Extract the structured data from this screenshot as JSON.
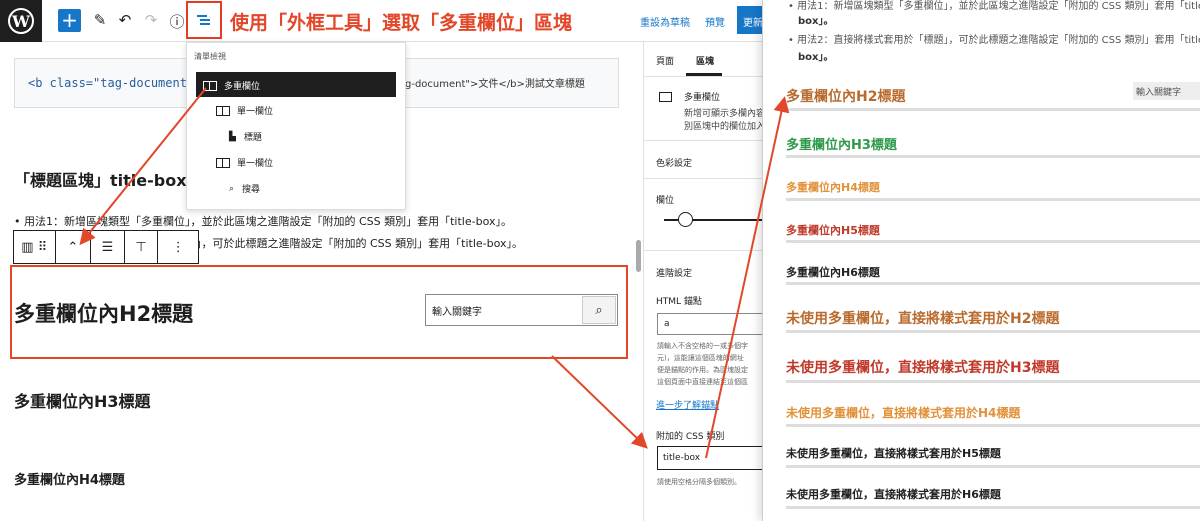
{
  "colors": {
    "accent": "#1677c9",
    "annotation": "#e24729",
    "dark": "#1e1e1e",
    "h2": "#b96b2e",
    "h3": "#2e9a4a",
    "h4": "#e1923a",
    "h5": "#c0392b",
    "h6": "#222222"
  },
  "topbar": {
    "caption": "使用「外框工具」選取「多重欄位」區塊",
    "save_draft": "重設為草稿",
    "preview": "預覽",
    "update": "更新"
  },
  "editor": {
    "code_left": "<b class=\"tag-document\"",
    "code_right": "g-document\">文件</b>測試文章標題",
    "heading": "「標題區塊」title-box",
    "usage1": "• 用法1：新增區塊類型「多重欄位」，並於此區塊之進階設定「附加的 CSS 類別」套用「title-box」。",
    "usage2": "」，可於此標題之進階設定「附加的 CSS 類別」套用「title-box」。",
    "h2": "多重欄位內H2標題",
    "search_placeholder": "輸入關鍵字",
    "h3": "多重欄位內H3標題",
    "h4": "多重欄位內H4標題"
  },
  "listview": {
    "title": "清單檢視",
    "items": [
      "多重欄位",
      "單一欄位",
      "標題",
      "單一欄位",
      "搜尋"
    ]
  },
  "sidebar": {
    "tab_page": "頁面",
    "tab_block": "區塊",
    "block_name": "多重欄位",
    "block_desc1": "新增可顯示多欄內容",
    "block_desc2": "別區塊中的欄位加入",
    "color_settings": "色彩設定",
    "columns_label": "欄位",
    "advanced": "進階設定",
    "html_anchor": "HTML 錨點",
    "anchor_value": "a",
    "anchor_help": [
      "請輸入不含空格的一或多個字",
      "元)，這能讓這個區塊的網址",
      "便是錨點的作用。為區塊設定",
      "這個頁面中直接連結至這個區"
    ],
    "learn_more": "進一步了解錨點",
    "css_class_label": "附加的 CSS 類別",
    "css_class_value": "title-box",
    "css_help": "請使用空格分隔多個類別。"
  },
  "preview_panel": {
    "top1": "• 用法1：新增區塊類型「多重欄位」，並於此區塊之進階設定「附加的 CSS 類別」套用「title-",
    "top1b": "box」。",
    "top2": "• 用法2：直接將樣式套用於「標題」，可於此標題之進階設定「附加的 CSS 類別」套用「title-",
    "top2b": "box」。",
    "search": "輸入關鍵字",
    "headings": [
      "多重欄位內H2標題",
      "多重欄位內H3標題",
      "多重欄位內H4標題",
      "多重欄位內H5標題",
      "多重欄位內H6標題",
      "未使用多重欄位，直接將樣式套用於H2標題",
      "未使用多重欄位，直接將樣式套用於H3標題",
      "未使用多重欄位，直接將樣式套用於H4標題",
      "未使用多重欄位，直接將樣式套用於H5標題",
      "未使用多重欄位，直接將樣式套用於H6標題"
    ]
  }
}
